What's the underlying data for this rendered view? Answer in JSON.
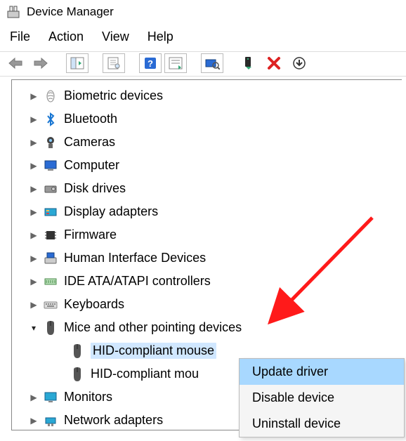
{
  "window": {
    "title": "Device Manager"
  },
  "menubar": {
    "file": "File",
    "action": "Action",
    "view": "View",
    "help": "Help"
  },
  "tree": {
    "items": [
      {
        "icon": "biometric",
        "label": "Biometric devices",
        "expanded": false
      },
      {
        "icon": "bluetooth",
        "label": "Bluetooth",
        "expanded": false
      },
      {
        "icon": "camera",
        "label": "Cameras",
        "expanded": false
      },
      {
        "icon": "computer",
        "label": "Computer",
        "expanded": false
      },
      {
        "icon": "disk",
        "label": "Disk drives",
        "expanded": false
      },
      {
        "icon": "display",
        "label": "Display adapters",
        "expanded": false
      },
      {
        "icon": "firmware",
        "label": "Firmware",
        "expanded": false
      },
      {
        "icon": "hid",
        "label": "Human Interface Devices",
        "expanded": false
      },
      {
        "icon": "ide",
        "label": "IDE ATA/ATAPI controllers",
        "expanded": false
      },
      {
        "icon": "keyboard",
        "label": "Keyboards",
        "expanded": false
      },
      {
        "icon": "mouse",
        "label": "Mice and other pointing devices",
        "expanded": true,
        "children": [
          {
            "icon": "mouse",
            "label": "HID-compliant mouse",
            "selected": true
          },
          {
            "icon": "mouse",
            "label": "HID-compliant mouse",
            "selected": false,
            "truncated": "HID-compliant mou"
          }
        ]
      },
      {
        "icon": "monitor",
        "label": "Monitors",
        "expanded": false
      },
      {
        "icon": "network",
        "label": "Network adapters",
        "expanded": false
      }
    ]
  },
  "context_menu": {
    "items": [
      {
        "label": "Update driver",
        "highlighted": true
      },
      {
        "label": "Disable device",
        "highlighted": false
      },
      {
        "label": "Uninstall device",
        "highlighted": false
      }
    ]
  }
}
